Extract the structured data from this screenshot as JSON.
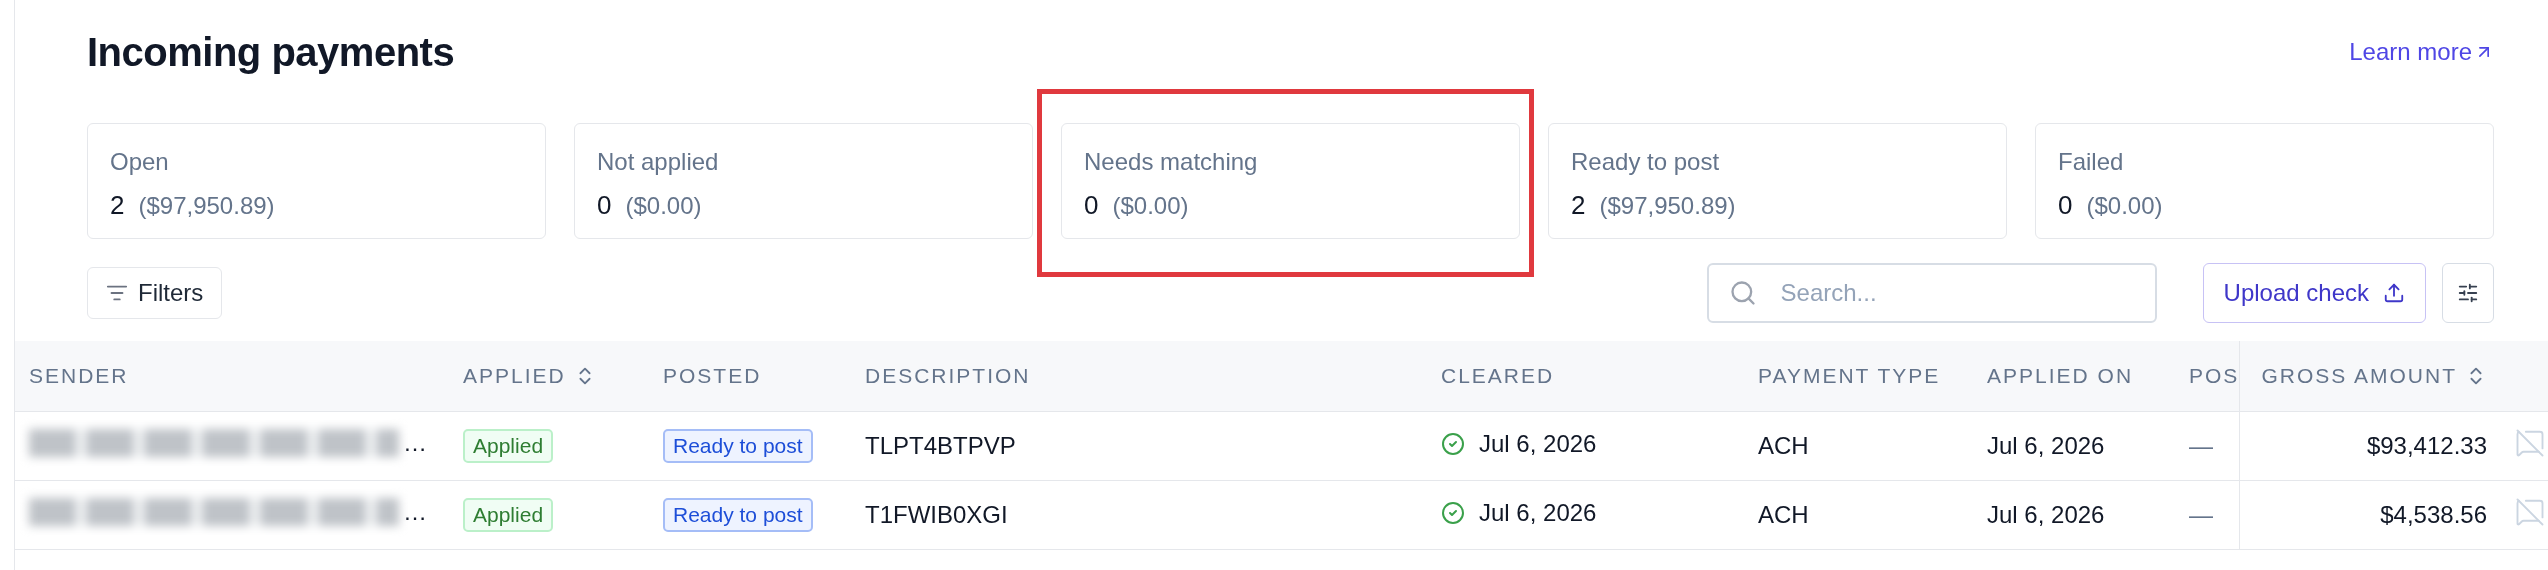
{
  "title": "Incoming payments",
  "learn_more": "Learn more",
  "summary_cards": [
    {
      "label": "Open",
      "count": "2",
      "amount": "($97,950.89)",
      "highlighted": false
    },
    {
      "label": "Not applied",
      "count": "0",
      "amount": "($0.00)",
      "highlighted": false
    },
    {
      "label": "Needs matching",
      "count": "0",
      "amount": "($0.00)",
      "highlighted": true
    },
    {
      "label": "Ready to post",
      "count": "2",
      "amount": "($97,950.89)",
      "highlighted": false
    },
    {
      "label": "Failed",
      "count": "0",
      "amount": "($0.00)",
      "highlighted": false
    }
  ],
  "filters_button": "Filters",
  "search": {
    "placeholder": "Search..."
  },
  "upload_button": "Upload check",
  "table": {
    "columns": [
      {
        "label": "SENDER",
        "sortable": false
      },
      {
        "label": "APPLIED",
        "sortable": true
      },
      {
        "label": "POSTED",
        "sortable": false
      },
      {
        "label": "DESCRIPTION",
        "sortable": false
      },
      {
        "label": "CLEARED",
        "sortable": false
      },
      {
        "label": "PAYMENT TYPE",
        "sortable": false
      },
      {
        "label": "APPLIED ON",
        "sortable": false
      },
      {
        "label": "POS"
      },
      {
        "label": "GROSS AMOUNT",
        "sortable": true
      }
    ],
    "rows": [
      {
        "sender": "…",
        "applied": "Applied",
        "posted": "Ready to post",
        "description": "TLPT4BTPVP",
        "cleared": {
          "date": "Jul 6, 2026",
          "done": true
        },
        "payment_type": "ACH",
        "applied_on": "Jul 6, 2026",
        "pos": "—",
        "gross_amount": "$93,412.33"
      },
      {
        "sender": "…",
        "applied": "Applied",
        "posted": "Ready to post",
        "description": "T1FWIB0XGI",
        "cleared": {
          "date": "Jul 6, 2026",
          "done": true
        },
        "payment_type": "ACH",
        "applied_on": "Jul 6, 2026",
        "pos": "—",
        "gross_amount": "$4,538.56"
      }
    ]
  }
}
